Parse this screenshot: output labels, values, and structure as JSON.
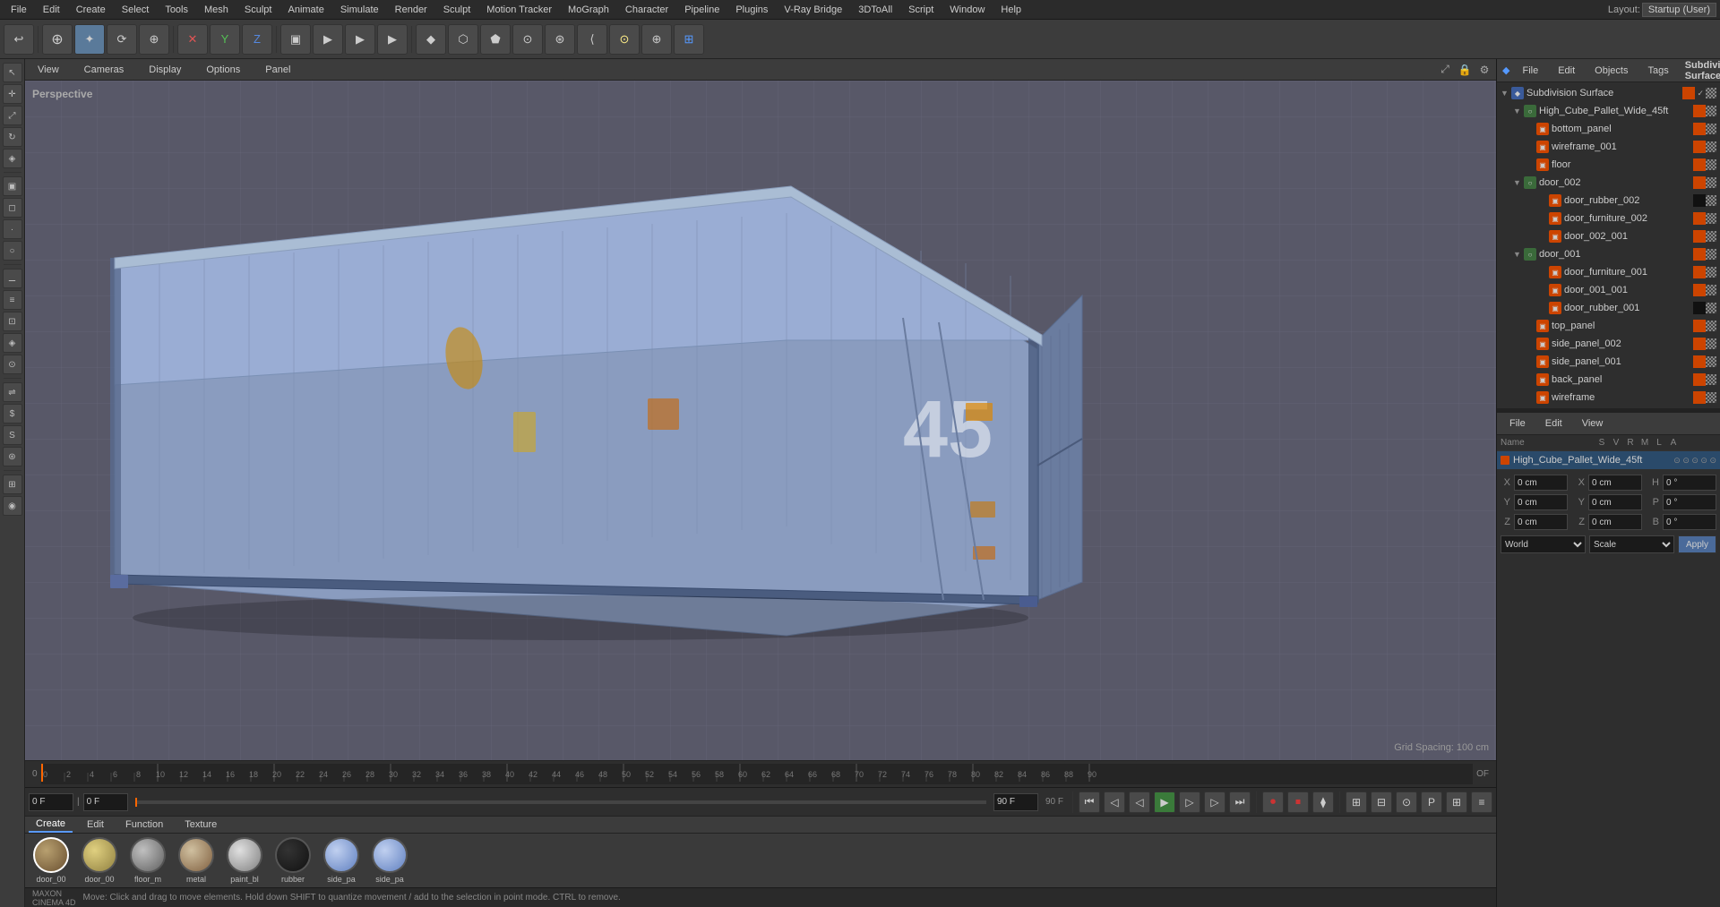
{
  "app": {
    "title": "Cinema 4D",
    "layout": "Layout:",
    "layout_value": "Startup (User)"
  },
  "menu": {
    "items": [
      "File",
      "Edit",
      "Create",
      "Select",
      "Tools",
      "Mesh",
      "Sculpt",
      "Animate",
      "Simulate",
      "Render",
      "Sculpt",
      "Motion Tracker",
      "MoGraph",
      "Character",
      "Pipeline",
      "Plugins",
      "V-Ray Bridge",
      "3DToAll",
      "Script",
      "Window",
      "Help"
    ]
  },
  "toolbar": {
    "buttons": [
      "↩",
      "⊕",
      "✦",
      "⟳",
      "⊕",
      "✕",
      "Y",
      "Z",
      "▣",
      "▶",
      "▶",
      "▶",
      "◆",
      "⬡",
      "⬟",
      "⊙",
      "⊛",
      "⟨",
      "⊙",
      "⊕",
      "⊞",
      "⟩",
      "◈"
    ]
  },
  "viewport": {
    "label": "Perspective",
    "tabs": [
      "View",
      "Cameras",
      "Display",
      "Options",
      "Panel"
    ],
    "grid_spacing": "Grid Spacing: 100 cm"
  },
  "object_manager": {
    "title": "Subdivision Surface",
    "header_tabs": [
      "File",
      "Edit",
      "Objects",
      "Tags"
    ],
    "objects": [
      {
        "name": "Subdivision Surface",
        "level": 0,
        "type": "subdivision",
        "icon": "blue",
        "has_check": true
      },
      {
        "name": "High_Cube_Pallet_Wide_45ft",
        "level": 1,
        "type": "group",
        "icon": "orange"
      },
      {
        "name": "bottom_panel",
        "level": 2,
        "type": "mesh",
        "icon": "orange"
      },
      {
        "name": "wireframe_001",
        "level": 2,
        "type": "mesh",
        "icon": "orange"
      },
      {
        "name": "floor",
        "level": 2,
        "type": "mesh",
        "icon": "orange"
      },
      {
        "name": "door_002",
        "level": 2,
        "type": "group",
        "icon": "blue"
      },
      {
        "name": "door_rubber_002",
        "level": 3,
        "type": "mesh",
        "icon": "orange"
      },
      {
        "name": "door_furniture_002",
        "level": 3,
        "type": "mesh",
        "icon": "orange"
      },
      {
        "name": "door_002_001",
        "level": 3,
        "type": "mesh",
        "icon": "orange"
      },
      {
        "name": "door_001",
        "level": 2,
        "type": "group",
        "icon": "blue"
      },
      {
        "name": "door_furniture_001",
        "level": 3,
        "type": "mesh",
        "icon": "orange"
      },
      {
        "name": "door_001_001",
        "level": 3,
        "type": "mesh",
        "icon": "orange"
      },
      {
        "name": "door_rubber_001",
        "level": 3,
        "type": "mesh",
        "icon": "orange"
      },
      {
        "name": "top_panel",
        "level": 2,
        "type": "mesh",
        "icon": "orange"
      },
      {
        "name": "side_panel_002",
        "level": 2,
        "type": "mesh",
        "icon": "orange"
      },
      {
        "name": "side_panel_001",
        "level": 2,
        "type": "mesh",
        "icon": "orange"
      },
      {
        "name": "back_panel",
        "level": 2,
        "type": "mesh",
        "icon": "orange"
      },
      {
        "name": "wireframe",
        "level": 2,
        "type": "mesh",
        "icon": "orange"
      }
    ]
  },
  "attr_manager": {
    "header_tabs": [
      "File",
      "Edit",
      "View"
    ],
    "col_headers": [
      "Name",
      "S",
      "V",
      "R",
      "M",
      "L",
      "A"
    ],
    "selected_item": "High_Cube_Pallet_Wide_45ft"
  },
  "timeline": {
    "marks": [
      0,
      2,
      4,
      6,
      8,
      10,
      12,
      14,
      16,
      18,
      20,
      22,
      24,
      26,
      28,
      30,
      32,
      34,
      36,
      38,
      40,
      42,
      44,
      46,
      48,
      50,
      52,
      54,
      56,
      58,
      60,
      62,
      64,
      66,
      68,
      70,
      72,
      74,
      76,
      78,
      80,
      82,
      84,
      86,
      88,
      90
    ],
    "frame_count": "OF",
    "current_frame": "0 F",
    "end_frame": "90 F",
    "playback_frame": "0 F",
    "playback_end": "90 F"
  },
  "materials": {
    "tabs": [
      "Create",
      "Edit",
      "Function",
      "Texture"
    ],
    "items": [
      {
        "name": "door_00",
        "color": "radial-gradient(circle at 35% 35%, #b8a070, #6a5030)",
        "selected": true
      },
      {
        "name": "door_00",
        "color": "radial-gradient(circle at 35% 35%, #e0d080, #908040)"
      },
      {
        "name": "floor_m",
        "color": "radial-gradient(circle at 35% 35%, #c0c0c0, #606060)"
      },
      {
        "name": "metal",
        "color": "radial-gradient(circle at 35% 35%, #d0c0a0, #806040)"
      },
      {
        "name": "paint_bl",
        "color": "radial-gradient(circle at 35% 35%, #e0e0e0, #808080)"
      },
      {
        "name": "rubber",
        "color": "radial-gradient(circle at 35% 35%, #333, #111)"
      },
      {
        "name": "side_pa",
        "color": "radial-gradient(circle at 35% 35%, #c0d0f0, #6080c0)"
      },
      {
        "name": "side_pa",
        "color": "radial-gradient(circle at 35% 35%, #c0d0f0, #6080c0)"
      }
    ]
  },
  "coordinates": {
    "x_label": "X",
    "x_val": "0 cm",
    "hx_label": "X",
    "hx_val": "0 cm",
    "h_label": "H",
    "h_val": "0 °",
    "y_label": "Y",
    "y_val": "0 cm",
    "hy_label": "Y",
    "hy_val": "0 cm",
    "p_label": "P",
    "p_val": "0 °",
    "z_label": "Z",
    "z_val": "0 cm",
    "hz_label": "Z",
    "hz_val": "0 cm",
    "b_label": "B",
    "b_val": "0 °",
    "coord_system": "World",
    "transform_mode": "Scale",
    "apply_label": "Apply"
  },
  "status": {
    "text": "Move: Click and drag to move elements. Hold down SHIFT to quantize movement / add to the selection in point mode. CTRL to remove."
  }
}
